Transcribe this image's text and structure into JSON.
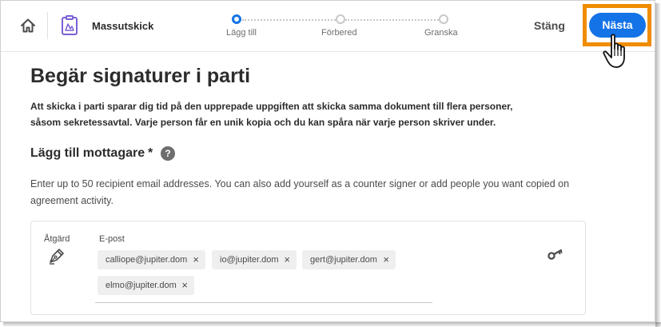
{
  "header": {
    "app_title": "Massutskick",
    "home_icon": "home-icon",
    "doc_icon": "clipboard-document-icon",
    "close_label": "Stäng",
    "next_label": "Nästa",
    "highlight_color": "#f08c00",
    "accent_color": "#1473e6"
  },
  "stepper": {
    "steps": [
      {
        "label": "Lägg till",
        "active": true
      },
      {
        "label": "Förbered",
        "active": false
      },
      {
        "label": "Granska",
        "active": false
      }
    ]
  },
  "main": {
    "title": "Begär signaturer i parti",
    "description": "Att skicka i parti sparar dig tid på den upprepade uppgiften att skicka samma dokument till flera personer, såsom sekretessavtal. Varje person får en unik kopia och du kan spåra när varje person skriver under.",
    "section_title": "Lägg till mottagare",
    "required_marker": "*",
    "help_glyph": "?",
    "instructions": "Enter up to 50 recipient email addresses. You can also add yourself as a counter signer or add people you want copied on agreement activity."
  },
  "recipient_card": {
    "action_label": "Åtgärd",
    "action_icon": "pen-sign-icon",
    "email_label": "E-post",
    "remove_glyph": "×",
    "key_icon": "key-icon",
    "emails": [
      "calliope@jupiter.dom",
      "io@jupiter.dom",
      "gert@jupiter.dom",
      "elmo@jupiter.dom"
    ]
  }
}
